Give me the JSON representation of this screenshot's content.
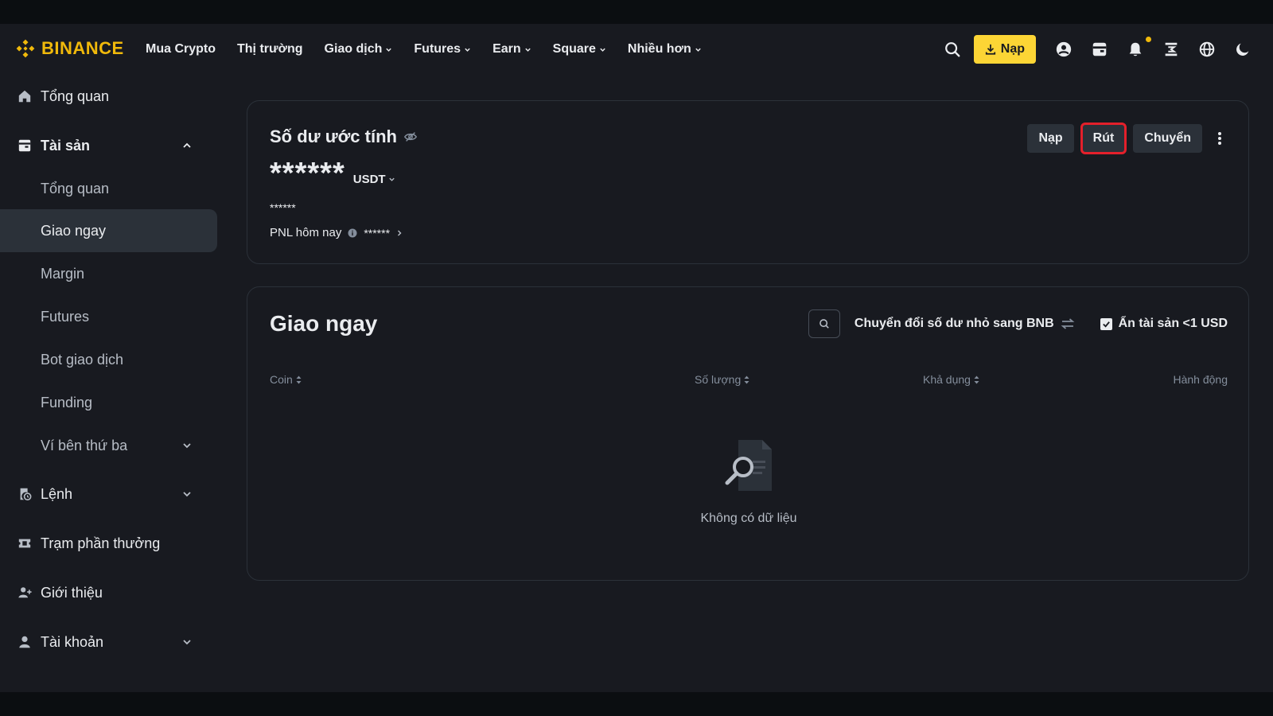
{
  "header": {
    "logo_text": "BINANCE",
    "nav": [
      {
        "label": "Mua Crypto",
        "has_dropdown": false
      },
      {
        "label": "Thị trường",
        "has_dropdown": false
      },
      {
        "label": "Giao dịch",
        "has_dropdown": true
      },
      {
        "label": "Futures",
        "has_dropdown": true
      },
      {
        "label": "Earn",
        "has_dropdown": true
      },
      {
        "label": "Square",
        "has_dropdown": true
      },
      {
        "label": "Nhiều hơn",
        "has_dropdown": true
      }
    ],
    "deposit_label": "Nạp",
    "icons": [
      "search-icon",
      "user-icon",
      "wallet-icon",
      "bell-icon",
      "transfer-icon",
      "globe-icon",
      "moon-icon"
    ]
  },
  "sidebar": {
    "items": [
      {
        "label": "Tổng quan",
        "icon": "home-icon"
      },
      {
        "label": "Tài sản",
        "icon": "wallet-icon",
        "expanded": true
      },
      {
        "label": "Tổng quan"
      },
      {
        "label": "Giao ngay",
        "active": true
      },
      {
        "label": "Margin"
      },
      {
        "label": "Futures"
      },
      {
        "label": "Bot giao dịch"
      },
      {
        "label": "Funding"
      },
      {
        "label": "Ví bên thứ ba"
      },
      {
        "label": "Lệnh",
        "icon": "orders-icon"
      },
      {
        "label": "Trạm phần thưởng",
        "icon": "ticket-icon"
      },
      {
        "label": "Giới thiệu",
        "icon": "add-user-icon"
      },
      {
        "label": "Tài khoản",
        "icon": "user-icon"
      }
    ]
  },
  "balance": {
    "title": "Số dư ước tính",
    "amount": "******",
    "unit": "USDT",
    "sub_amount": "******",
    "pnl_label": "PNL hôm nay",
    "pnl_value": "******",
    "actions": {
      "deposit": "Nạp",
      "withdraw": "Rút",
      "transfer": "Chuyển"
    }
  },
  "spot": {
    "title": "Giao ngay",
    "convert_label": "Chuyển đổi số dư nhỏ sang BNB",
    "hide_small_label": "Ẩn tài sản <1 USD",
    "hide_small_checked": true,
    "columns": {
      "coin": "Coin",
      "quantity": "Số lượng",
      "available": "Khả dụng",
      "action": "Hành động"
    },
    "empty_text": "Không có dữ liệu"
  },
  "colors": {
    "brand": "#f0b90b",
    "bg": "#181a20",
    "card_border": "#2b3139",
    "highlight": "#e4202b"
  }
}
